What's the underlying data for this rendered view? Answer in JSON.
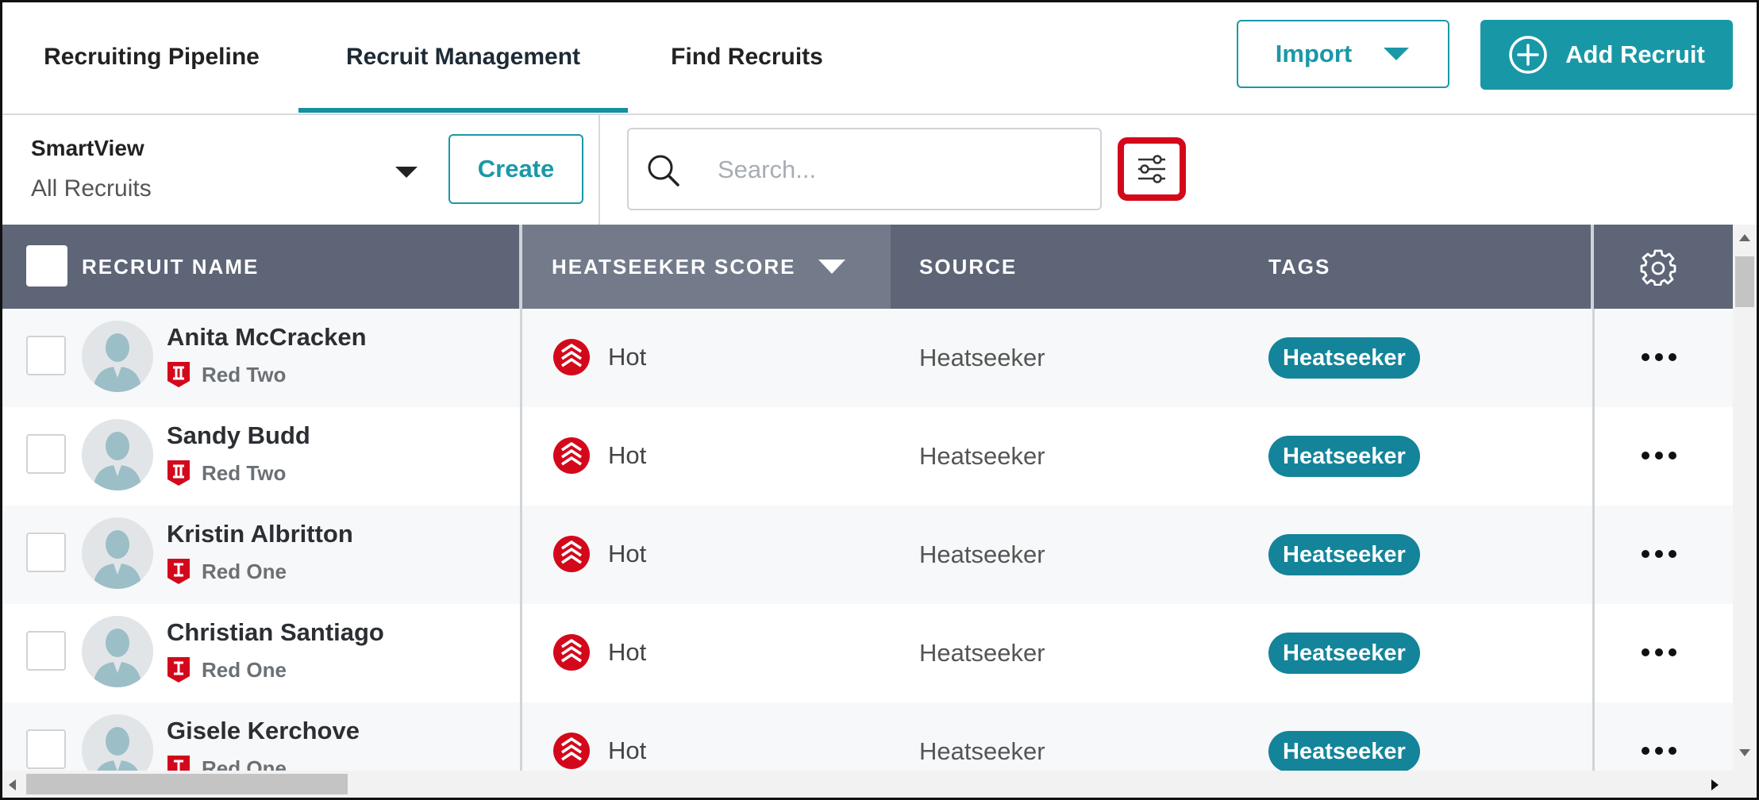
{
  "tabs": [
    {
      "label": "Recruiting Pipeline"
    },
    {
      "label": "Recruit Management"
    },
    {
      "label": "Find Recruits"
    }
  ],
  "actions": {
    "import_label": "Import",
    "add_label": "Add Recruit"
  },
  "smartview": {
    "label": "SmartView",
    "value": "All Recruits",
    "create_label": "Create"
  },
  "search": {
    "placeholder": "Search..."
  },
  "table": {
    "columns": {
      "name": "RECRUIT NAME",
      "score": "HEATSEEKER SCORE",
      "source": "SOURCE",
      "tags": "TAGS"
    },
    "rows": [
      {
        "name": "Anita McCracken",
        "level": "Red Two",
        "score": "Hot",
        "source": "Heatseeker",
        "tag": "Heatseeker"
      },
      {
        "name": "Sandy Budd",
        "level": "Red Two",
        "score": "Hot",
        "source": "Heatseeker",
        "tag": "Heatseeker"
      },
      {
        "name": "Kristin Albritton",
        "level": "Red One",
        "score": "Hot",
        "source": "Heatseeker",
        "tag": "Heatseeker"
      },
      {
        "name": "Christian Santiago",
        "level": "Red One",
        "score": "Hot",
        "source": "Heatseeker",
        "tag": "Heatseeker"
      },
      {
        "name": "Gisele Kerchove",
        "level": "Red One",
        "score": "Hot",
        "source": "Heatseeker",
        "tag": "Heatseeker"
      }
    ]
  },
  "colors": {
    "accent": "#1898a6",
    "header": "#5d6577",
    "hot": "#d3091b",
    "tag": "#13849a"
  }
}
